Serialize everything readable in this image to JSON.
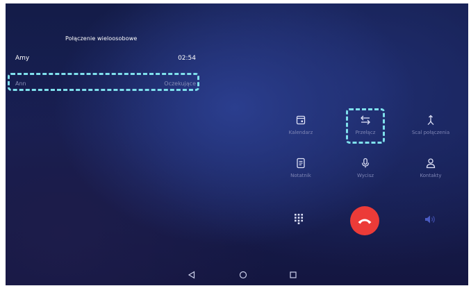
{
  "conference": {
    "title": "Połączenie wieloosobowe"
  },
  "calls": [
    {
      "name": "Amy",
      "status": "02:54"
    },
    {
      "name": "Ann",
      "status": "Oczekujące"
    }
  ],
  "actions": [
    {
      "label": "Kalendarz",
      "icon": "calendar-icon"
    },
    {
      "label": "Przełącz",
      "icon": "swap-icon"
    },
    {
      "label": "Scal połączenia",
      "icon": "merge-icon"
    },
    {
      "label": "Notatnik",
      "icon": "notepad-icon"
    },
    {
      "label": "Wycisz",
      "icon": "microphone-icon"
    },
    {
      "label": "Kontakty",
      "icon": "contacts-icon"
    }
  ],
  "controls": {
    "dialpad": "dialpad-icon",
    "end_call": "end-call-icon",
    "speaker": "speaker-icon"
  },
  "navigation": {
    "back": "back-icon",
    "home": "home-icon",
    "recents": "recents-icon"
  },
  "colors": {
    "highlight": "#7fe0ec",
    "end_call": "#ec3b38",
    "background": "#172055",
    "label": "#7f86b5"
  }
}
